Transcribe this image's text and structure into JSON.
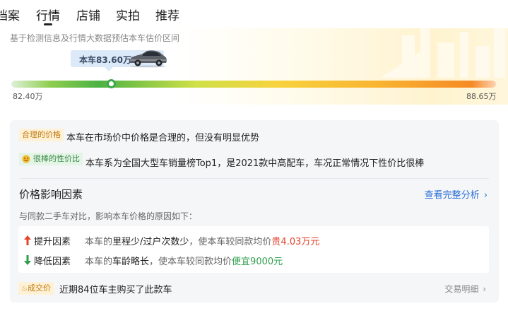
{
  "tabs": [
    {
      "label": "档案"
    },
    {
      "label": "行情"
    },
    {
      "label": "店铺"
    },
    {
      "label": "实拍"
    },
    {
      "label": "推荐"
    }
  ],
  "active_tab": "行情",
  "valuation": {
    "subtitle": "基于检测信息及行情大数据预估本车估价区间",
    "current_price": "本车83.60万",
    "min_label": "82.40万",
    "max_label": "88.65万",
    "marker_position_fraction": 0.2
  },
  "assessments": [
    {
      "tag": "合理的价格",
      "text": "本车在市场价中价格是合理的，但没有明显优势",
      "icon": null
    },
    {
      "tag": "很棒的性价比",
      "text": "本车系为全国大型车销量榜Top1，是2021款中高配车，车况正常情况下性价比很棒",
      "icon": "smiley-icon"
    }
  ],
  "factors": {
    "title": "价格影响因素",
    "link": "查看完整分析",
    "note": "与同款二手车对比，影响本车价格的原因如下：",
    "up": {
      "label": "提升因素",
      "desc_prefix": "本车的",
      "desc_strong": "里程少/过户次数少",
      "desc_mid": "，使本车较同款均价",
      "highlight": "贵4.03万元"
    },
    "down": {
      "label": "降低因素",
      "desc_prefix": "本车的",
      "desc_strong": "车龄略长",
      "desc_mid": "，使本车较同款均价",
      "highlight": "便宜9000元"
    }
  },
  "deal": {
    "tag": "成交价",
    "text": "近期84位车主购买了此款车",
    "link": "交易明细"
  },
  "colors": {
    "up_arrow": "#e2452c",
    "down_arrow": "#2f9f4d",
    "link": "#2a6fd6",
    "tag_orange_bg": "#fff1d6",
    "tag_green_bg": "#e4f4e6"
  }
}
